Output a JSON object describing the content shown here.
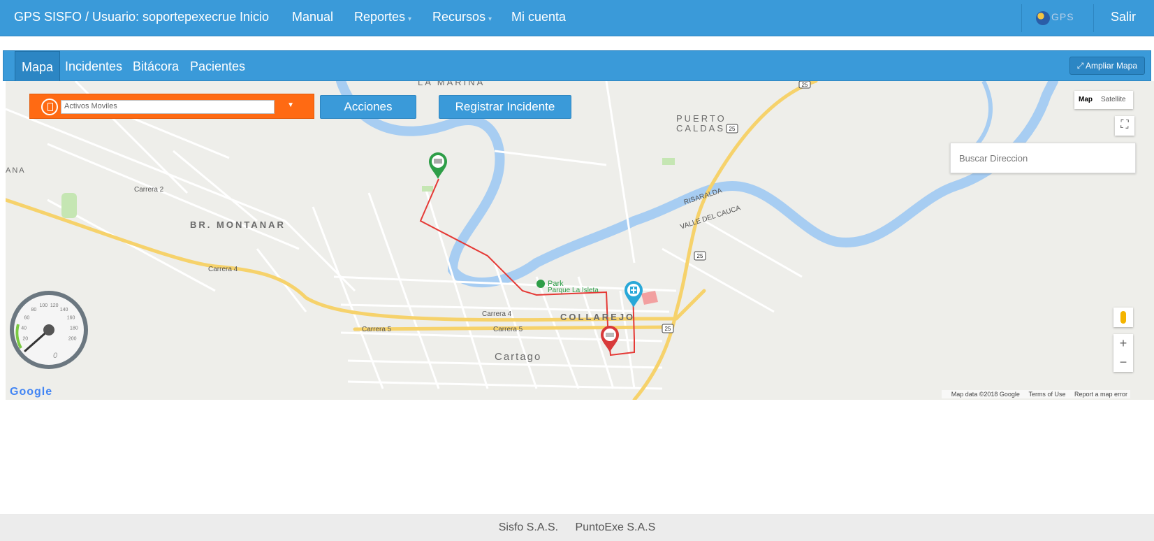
{
  "navbar": {
    "brand": "GPS SISFO / Usuario: soportepexecrue",
    "items": [
      {
        "label": "Inicio",
        "dropdown": false
      },
      {
        "label": "Manual",
        "dropdown": false
      },
      {
        "label": "Reportes",
        "dropdown": true
      },
      {
        "label": "Recursos",
        "dropdown": true
      },
      {
        "label": "Mi cuenta",
        "dropdown": false
      }
    ],
    "logo_text": "GPS",
    "logout_label": "Salir"
  },
  "tabs": [
    {
      "label": "Mapa",
      "active": true
    },
    {
      "label": "Incidentes",
      "active": false
    },
    {
      "label": "Bitácora",
      "active": false
    },
    {
      "label": "Pacientes",
      "active": false
    }
  ],
  "expand_map_label": "Ampliar Mapa",
  "map_controls": {
    "moviles_select_value": "Activos Moviles",
    "acciones_label": "Acciones",
    "registrar_label": "Registrar Incidente",
    "search_placeholder": "Buscar Direccion",
    "map_type_map": "Map",
    "map_type_satellite": "Satellite",
    "zoom_in": "+",
    "zoom_out": "−"
  },
  "map_labels": {
    "la_marina": "LA MARINA",
    "puerto_caldas_1": "PUERTO",
    "puerto_caldas_2": "CALDAS",
    "montanar": "BR. MONTANAR",
    "collarejo": "COLLAREJO",
    "cartago": "Cartago",
    "risaralda": "RISARALDA",
    "valle": "VALLE DEL CAUCA",
    "park_1": "Park",
    "park_2": "Parque La Isleta",
    "carrera_4": "Carrera 4",
    "carrera_5": "Carrera 5",
    "carrera_2": "Carrera 2",
    "na": "ANA",
    "route_25": "25"
  },
  "attribution": {
    "data": "Map data ©2018 Google",
    "terms": "Terms of Use",
    "report": "Report a map error",
    "google": "Google"
  },
  "speedometer": {
    "ticks": [
      "20",
      "40",
      "60",
      "80",
      "100",
      "120",
      "140",
      "160",
      "180",
      "200"
    ],
    "reading": "0"
  },
  "colors": {
    "primary": "#3a9ad9",
    "select_orange": "#ff6a13",
    "route_red": "#e53935",
    "marker_green": "#2e9e48",
    "marker_red": "#d83a3a",
    "marker_teal": "#29a8d8"
  },
  "footer": {
    "company_1": "Sisfo S.A.S.",
    "company_2": "PuntoExe S.A.S"
  }
}
